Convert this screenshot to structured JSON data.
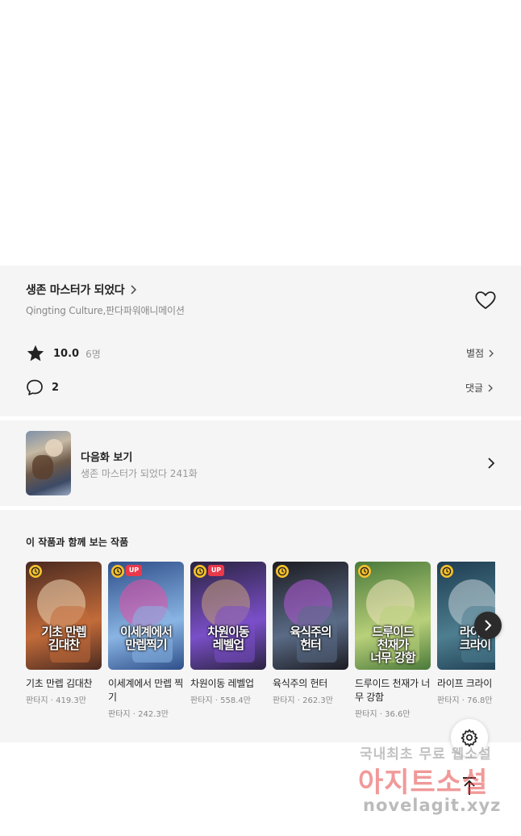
{
  "work": {
    "title": "생존 마스터가 되었다",
    "authors": "Qingting Culture,판다파워애니메이션"
  },
  "rating": {
    "value": "10.0",
    "count": "6명",
    "link_label": "별점"
  },
  "comments": {
    "count": "2",
    "link_label": "댓글"
  },
  "next_episode": {
    "label": "다음화 보기",
    "subtitle": "생존 마스터가 되었다 241화"
  },
  "recommendations": {
    "heading": "이 작품과 함께 보는 작품",
    "items": [
      {
        "title": "기초 만렙 김대찬",
        "meta": "판타지 · 419.3만",
        "cover_text": "기초 만렙\n김대찬",
        "up": false,
        "colors": [
          "#4a2a20",
          "#c26b3a",
          "#f0d8b8"
        ]
      },
      {
        "title": "이세계에서 만렙 찍기",
        "meta": "판타지 · 242.3만",
        "cover_text": "이세계에서\n만렙찍기",
        "up": true,
        "up_label": "UP",
        "colors": [
          "#2e4f8a",
          "#89b4e3",
          "#e84fa6"
        ]
      },
      {
        "title": "차원이동 레벨업",
        "meta": "판타지 · 558.4만",
        "cover_text": "차원이동\n레벨업",
        "up": true,
        "up_label": "UP",
        "colors": [
          "#2a2340",
          "#7a4fc8",
          "#c9a37a"
        ]
      },
      {
        "title": "육식주의 헌터",
        "meta": "판타지 · 262.3만",
        "cover_text": "육식주의\n헌터",
        "up": false,
        "colors": [
          "#1c1c22",
          "#5a6b86",
          "#b55ad8"
        ]
      },
      {
        "title": "드루이드 천재가 너무 강함",
        "meta": "판타지 · 36.6만",
        "cover_text": "드루이드\n천재가\n너무 강함",
        "up": false,
        "colors": [
          "#4b7a3a",
          "#b8d07a",
          "#f2e6c0"
        ]
      },
      {
        "title": "라이프 크라이",
        "meta": "판타지 · 76.8만",
        "cover_text": "라이프\n크라이",
        "up": false,
        "colors": [
          "#1f3d52",
          "#4d7e8f",
          "#c9d6da"
        ]
      }
    ]
  },
  "watermark": {
    "line1": "국내최초 무료 웹소설",
    "line2": "아지트소설",
    "line3": "novelagit.xyz"
  },
  "icons": {
    "star": "star-icon",
    "comment": "comment-bubble-icon",
    "heart": "heart-icon",
    "chevron": "chevron-right-icon",
    "clock": "clock-icon",
    "settings": "gear-icon",
    "top": "arrow-up-icon"
  },
  "colors": {
    "section_bg": "#f5f5f5",
    "badge_clock": "#f5c02a",
    "badge_up": "#e9394b"
  }
}
